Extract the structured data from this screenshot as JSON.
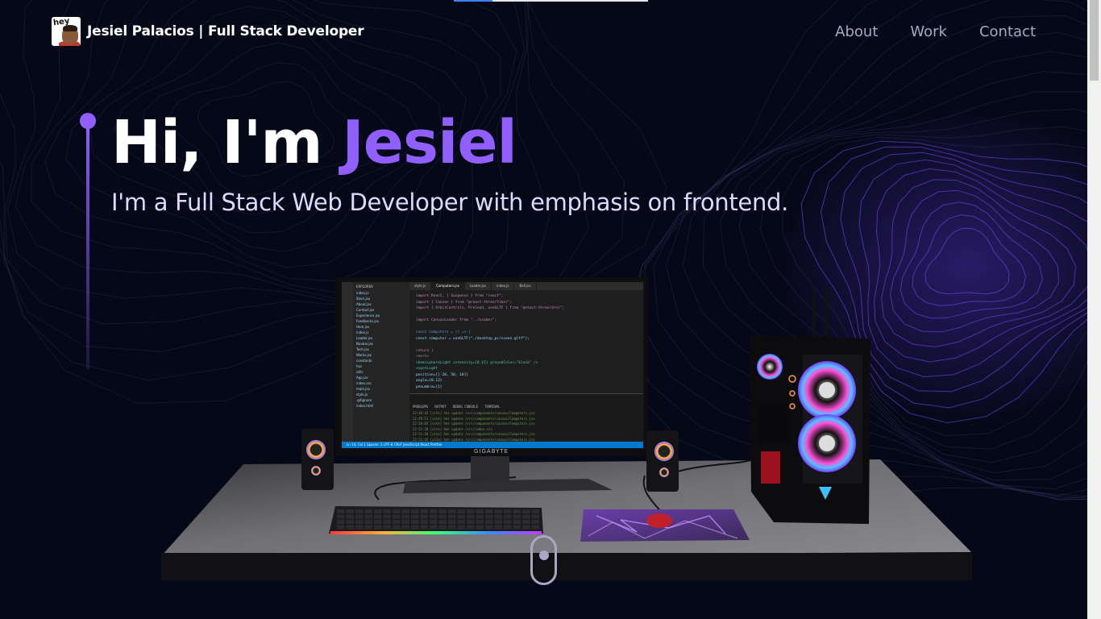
{
  "progress": {
    "percent": 20
  },
  "nav": {
    "brand": "Jesiel Palacios",
    "brand_suffix": " | Full Stack Developer",
    "logo_text": "hey",
    "links": [
      {
        "label": "About"
      },
      {
        "label": "Work"
      },
      {
        "label": "Contact"
      }
    ]
  },
  "hero": {
    "greeting": "Hi, I'm ",
    "name": "Jesiel",
    "subtitle": "I'm a Full Stack Web Developer with emphasis on frontend."
  },
  "monitor": {
    "brand": "GIGABYTE",
    "explorer_title": "EXPLORER",
    "files": [
      "index.js",
      "Stars.jsx",
      "About.jsx",
      "Contact.jsx",
      "Experience.jsx",
      "Feedbacks.jsx",
      "Hero.jsx",
      "index.js",
      "Loader.jsx",
      "Navbar.jsx",
      "Tech.jsx",
      "Works.jsx",
      "constants",
      "hoc",
      "utils",
      "App.jsx",
      "index.css",
      "main.jsx",
      "style.js",
      ".gitignore",
      "index.html"
    ],
    "tabs": [
      "style.js",
      "Computers.jsx",
      "Loader.jsx",
      "index.js",
      "Ball.jsx"
    ],
    "code_lines": [
      "import React, { Suspense } from \"react\";",
      "import { Canvas } from \"@react-three/fiber\";",
      "import { OrbitControls, Preload, useGLTF } from \"@react-three/drei\";",
      "",
      "import CanvasLoader from \"../Loader\";",
      "",
      "const Computers = () => {",
      "  const computer = useGLTF(\"./desktop_pc/scene.gltf\");",
      "",
      "  return (",
      "    <mesh>",
      "      <hemisphereLight intensity={0.15} groundColor=\"black\" />",
      "      <spotLight",
      "        position={[-20, 50, 10]}",
      "        angle={0.12}",
      "        penumbra={1}"
    ],
    "terminal_tabs": [
      "PROBLEMS",
      "OUTPUT",
      "DEBUG CONSOLE",
      "TERMINAL"
    ],
    "terminal_lines": [
      "22:49:42 [vite] hmr update /src/components/canvas/Computers.jsx",
      "22:49:51 [vite] hmr update /src/components/canvas/Computers.jsx",
      "22:50:03 [vite] hmr update /src/components/canvas/Computers.jsx",
      "22:51:20 [vite] hmr update /src/index.css",
      "22:51:34 [vite] hmr update /src/components/canvas/Computers.jsx",
      "22:51:45 [vite] hmr update /src/components/canvas/Computers.jsx"
    ],
    "status_bar": "Ln 14, Col 1   Spaces: 2   UTF-8   CRLF   JavaScript React   Prettier"
  },
  "colors": {
    "background": "#050816",
    "accent": "#915eff",
    "nav_link": "#aaa6c3",
    "subtitle": "#dfd9ff"
  },
  "icons": [
    "hey-avatar-logo",
    "mouse-scroll-icon"
  ]
}
